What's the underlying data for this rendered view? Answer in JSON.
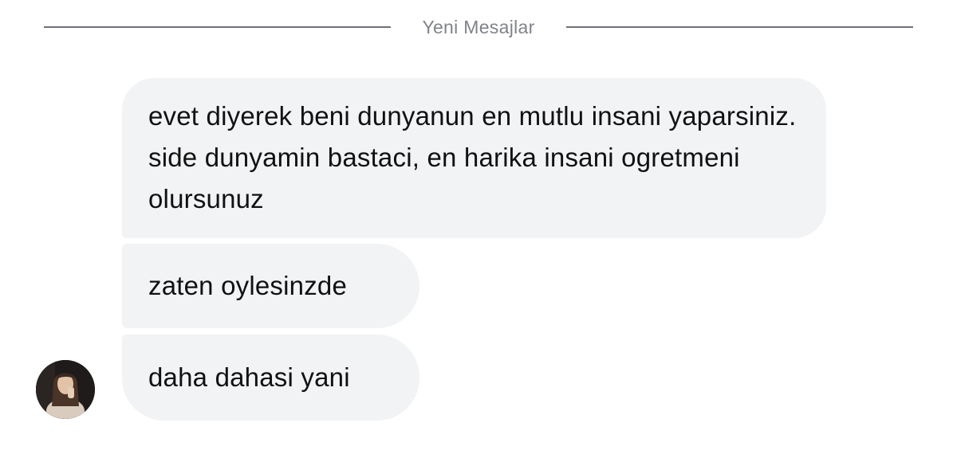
{
  "divider": {
    "label": "Yeni Mesajlar"
  },
  "messages": [
    {
      "text": "evet diyerek beni dunyanun en mutlu insani yaparsiniz. side dunyamin bastaci, en harika insani ogretmeni olursunuz"
    },
    {
      "text": "zaten oylesinzde"
    },
    {
      "text": "daha dahasi yani"
    }
  ],
  "sender": {
    "avatar_icon": "profile-photo"
  },
  "colors": {
    "bubble_bg": "#f2f3f5",
    "divider_line": "#6f7176",
    "divider_text": "#808389",
    "message_text": "#111111"
  }
}
